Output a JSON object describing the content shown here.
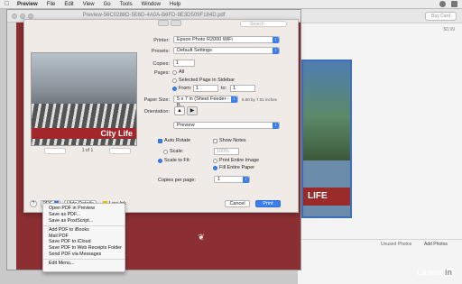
{
  "menubar": {
    "app_name": "Preview",
    "items": [
      "File",
      "Edit",
      "View",
      "Go",
      "Tools",
      "Window",
      "Help"
    ]
  },
  "window": {
    "title": "Preview-56C0288D-5E6D-4A0A-B6FD-9E3D509F184D.pdf",
    "search_placeholder": "Search"
  },
  "print": {
    "printer_label": "Printer:",
    "printer_value": "Epson Photo R2000 WiFi",
    "presets_label": "Presets:",
    "presets_value": "Default Settings",
    "copies_label": "Copies:",
    "copies_value": "1",
    "pages_label": "Pages:",
    "pages_all": "All",
    "pages_selected": "Selected Page in Sidebar",
    "pages_from": "From:",
    "from_value": "1",
    "to_label": "to:",
    "to_value": "1",
    "paper_size_label": "Paper Size:",
    "paper_size_value": "5 x 7 in (Sheet Feeder - B...",
    "paper_dims": "5.00 by 7.01 inches",
    "orientation_label": "Orientation:",
    "app_section": "Preview",
    "auto_rotate": "Auto Rotate",
    "show_notes": "Show Notes",
    "scale_label": "Scale:",
    "scale_value": "100%",
    "scale_to_fit": "Scale to Fit:",
    "print_entire_image": "Print Entire Image",
    "fill_entire_paper": "Fill Entire Paper",
    "copies_per_page_label": "Copies per page:",
    "copies_per_page_value": "1",
    "page_indicator": "1 of 1",
    "photo_caption": "City Life",
    "pdf_button": "PDF",
    "hide_details": "Hide Details",
    "low_ink": "Low Ink",
    "cancel": "Cancel",
    "print": "Print",
    "help": "?"
  },
  "pdf_menu": {
    "items": [
      "Open PDF in Preview",
      "Save as PDF...",
      "Save as PostScript...",
      "Add PDF to iBooks",
      "Mail PDF",
      "Save PDF to iCloud",
      "Save PDF to Web Receipts Folder",
      "Send PDF via Messages",
      "Edit Menu..."
    ]
  },
  "background_app": {
    "buy_card": "Buy Card",
    "price": "$0.99",
    "card_text": "LIFE",
    "unused_photos": "Unused Photos",
    "add_photos": "Add Photos"
  },
  "watermark": {
    "brand_prefix": "Linked",
    "brand_suffix": "in"
  },
  "colors": {
    "accent": "#3a7ff0",
    "card_red": "#a3262b"
  }
}
